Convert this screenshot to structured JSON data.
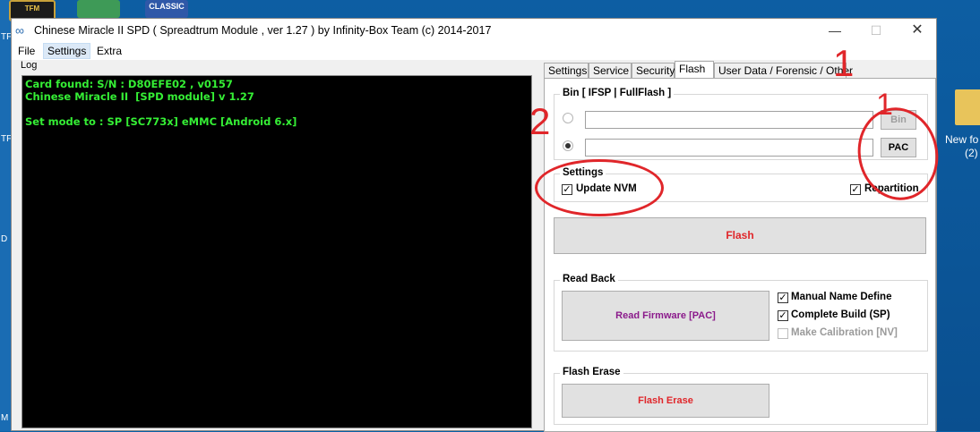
{
  "desktop": {
    "left_strip_labels": [
      "TF",
      "TF",
      "D",
      "M"
    ],
    "icons": {
      "tfm": "TFM",
      "classic": "CLASSIC"
    },
    "folder_label_line1": "New fo",
    "folder_label_line2": "(2)"
  },
  "window": {
    "title": "Chinese Miracle II SPD ( Spreadtrum Module , ver 1.27 ) by Infinity-Box Team (c) 2014-2017",
    "minimize_glyph": "—",
    "maximize_glyph": "☐",
    "close_glyph": "✕"
  },
  "menu": {
    "file": "File",
    "settings": "Settings",
    "extra": "Extra"
  },
  "log": {
    "label": "Log",
    "lines": [
      "Card found: S/N : D80EFE02 , v0157",
      "Chinese Miracle II  [SPD module] v 1.27",
      "",
      "Set mode to : SP [SC773x] eMMC [Android 6.x]"
    ]
  },
  "tabs": [
    "Settings",
    "Service",
    "Security",
    "Flash",
    "User Data / Forensic / Other"
  ],
  "active_tab": "Flash",
  "bin_group": {
    "title": "Bin  [ IFSP | FullFlash ]",
    "bin_button": "Bin",
    "pac_button": "PAC"
  },
  "settings_group": {
    "title": "Settings",
    "update_nvm": "Update NVM",
    "repartition": "Repartition"
  },
  "flash_button": "Flash",
  "read_back": {
    "title": "Read Back",
    "read_firmware_button": "Read Firmware [PAC]",
    "manual_name_define": "Manual Name Define",
    "complete_build": "Complete Build (SP)",
    "make_calibration": "Make Calibration [NV]"
  },
  "flash_erase": {
    "title": "Flash Erase",
    "button": "Flash Erase"
  },
  "annotations": {
    "one_a": "1",
    "one_b": "1",
    "two": "2"
  },
  "colors": {
    "flash_text": "#e0262a",
    "read_firmware_text": "#8b1a8b",
    "log_text": "#35ef35",
    "annotation": "#e0262a"
  }
}
